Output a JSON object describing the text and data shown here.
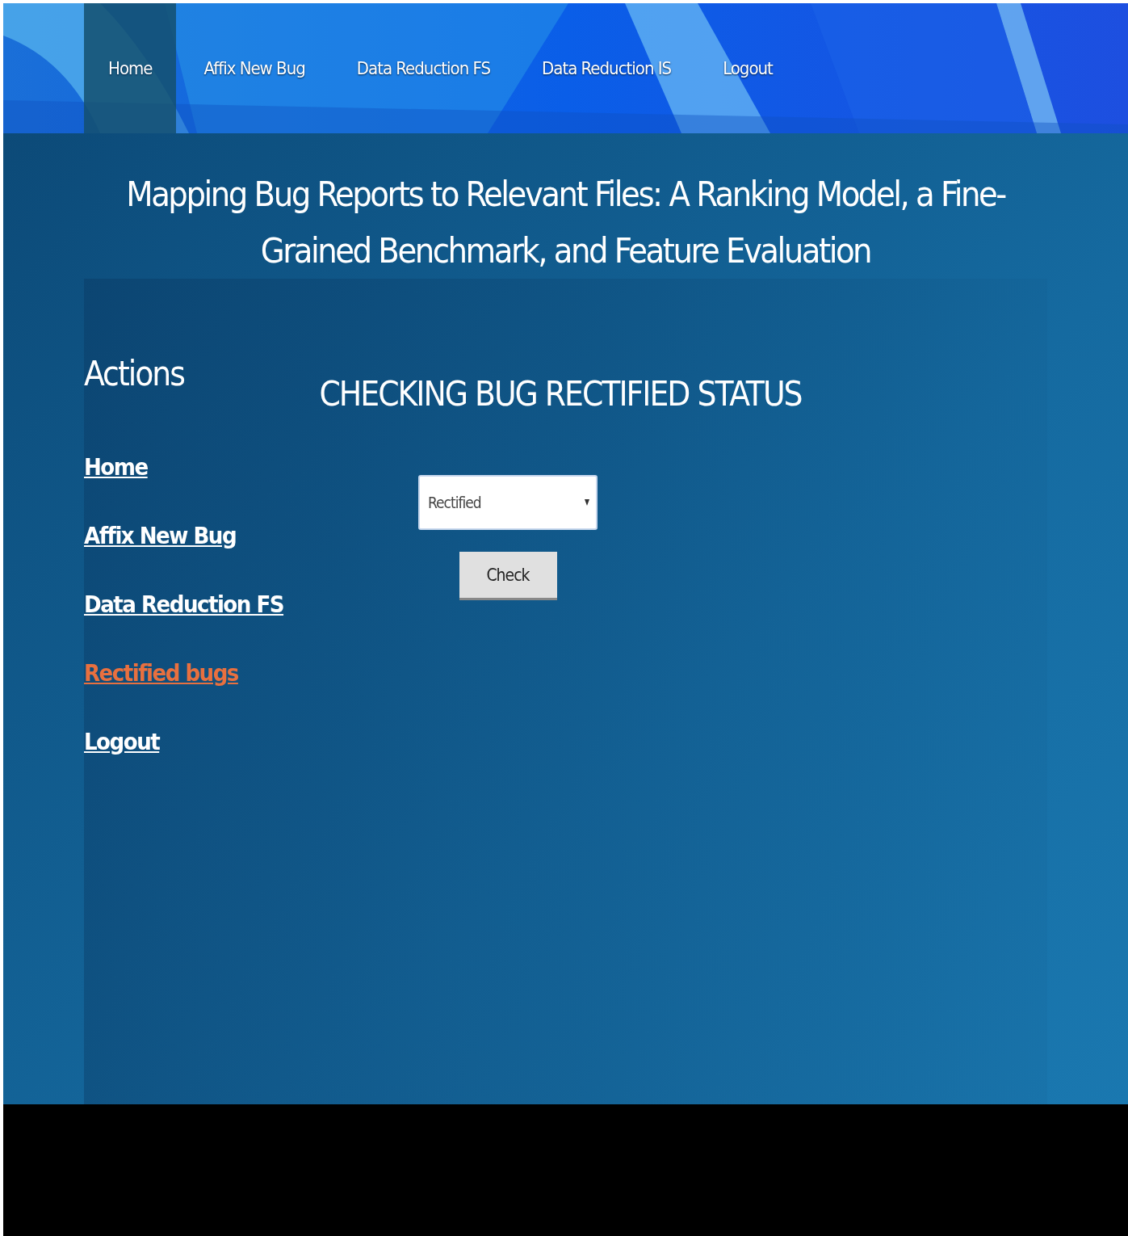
{
  "top_nav": [
    {
      "label": "Home",
      "selected": true
    },
    {
      "label": "Affix New Bug",
      "selected": false
    },
    {
      "label": "Data Reduction FS",
      "selected": false
    },
    {
      "label": "Data Reduction IS",
      "selected": false
    },
    {
      "label": "Logout",
      "selected": false
    }
  ],
  "page_title": "Mapping Bug Reports to Relevant Files: A Ranking Model, a Fine-Grained Benchmark, and Feature Evaluation",
  "sidebar": {
    "heading": "Actions",
    "links": [
      {
        "label": "Home",
        "selected": false
      },
      {
        "label": "Affix New Bug",
        "selected": false
      },
      {
        "label": "Data Reduction FS",
        "selected": false
      },
      {
        "label": "Rectified bugs",
        "selected": true
      },
      {
        "label": "Logout",
        "selected": false
      }
    ]
  },
  "main": {
    "heading": "CHECKING BUG RECTIFIED STATUS",
    "status_select": {
      "value": "Rectified"
    },
    "button": "Check"
  }
}
